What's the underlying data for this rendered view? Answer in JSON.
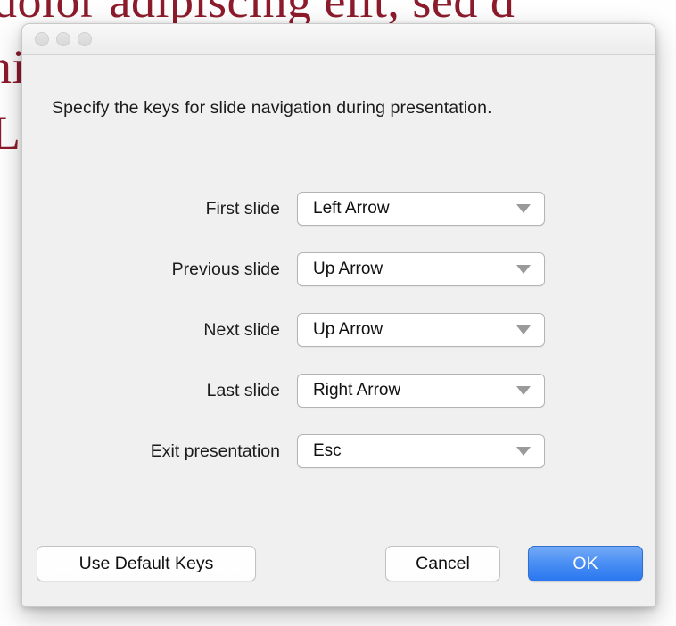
{
  "background": {
    "line_1": "dolor adipiscing elit, sed d",
    "line_2": "nim",
    "line_3": "Lor"
  },
  "dialog": {
    "window_controls": [
      {
        "name": "close-button",
        "color": "#dcdcdc"
      },
      {
        "name": "minimize-button",
        "color": "#dcdcdc"
      },
      {
        "name": "zoom-button",
        "color": "#dcdcdc"
      }
    ],
    "intro_text": "Specify the keys for slide navigation during presentation.",
    "rows": [
      {
        "label": "First slide",
        "value": "Left Arrow"
      },
      {
        "label": "Previous slide",
        "value": "Up Arrow"
      },
      {
        "label": "Next slide",
        "value": "Up Arrow"
      },
      {
        "label": "Last slide",
        "value": "Right Arrow"
      },
      {
        "label": "Exit presentation",
        "value": "Esc"
      }
    ],
    "footer": {
      "default_keys_label": "Use Default Keys",
      "cancel_label": "Cancel",
      "ok_label": "OK"
    },
    "accent_color": "#4b8ff4"
  }
}
